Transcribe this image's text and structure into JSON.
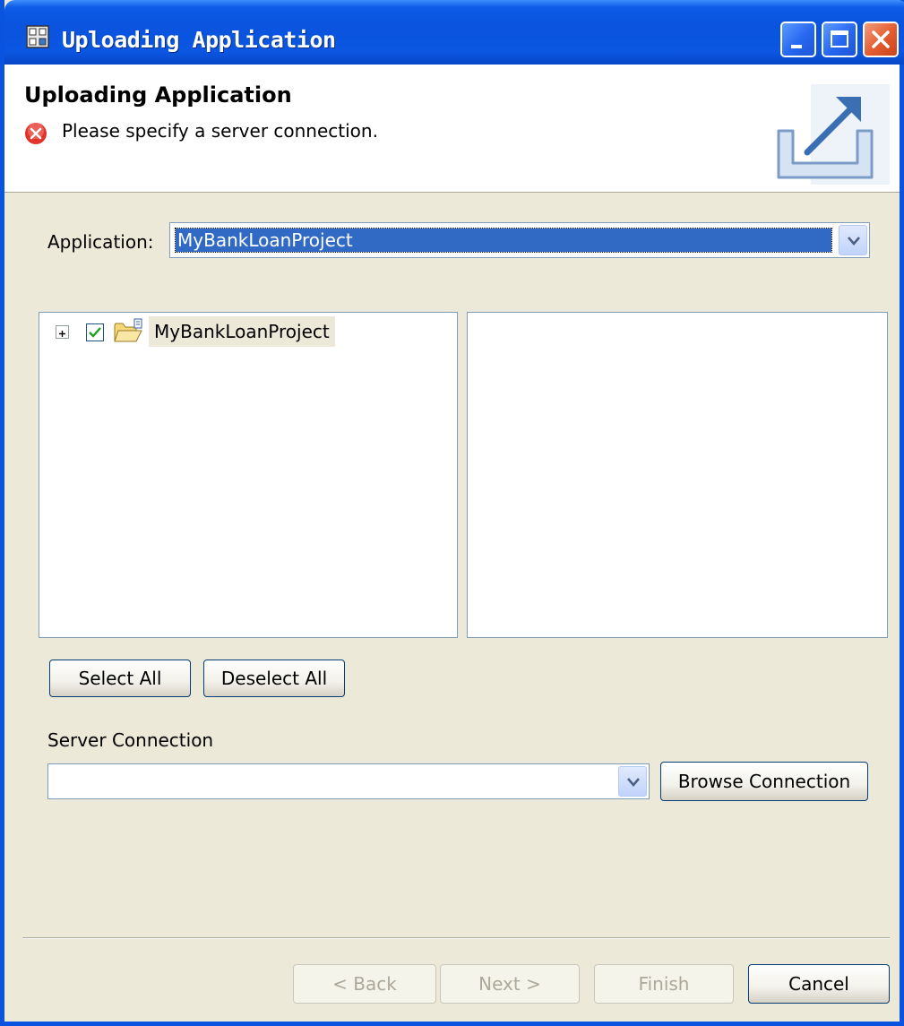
{
  "window": {
    "title": "Uploading Application"
  },
  "header": {
    "title": "Uploading Application",
    "message": "Please specify a server connection.",
    "message_icon": "error-icon",
    "graphic_icon": "upload-icon"
  },
  "application": {
    "label": "Application:",
    "selected_value": "MyBankLoanProject"
  },
  "tree": {
    "items": [
      {
        "label": "MyBankLoanProject",
        "checked": true,
        "expanded": false
      }
    ]
  },
  "selection_buttons": {
    "select_all": "Select All",
    "deselect_all": "Deselect All"
  },
  "server_connection": {
    "label": "Server Connection",
    "value": "",
    "browse_button": "Browse Connection"
  },
  "footer": {
    "back": "< Back",
    "next": "Next >",
    "finish": "Finish",
    "cancel": "Cancel"
  },
  "colors": {
    "titlebar": "#0a54df",
    "dialog_background": "#ece9d8",
    "selection": "#316ac5",
    "error": "#e0332b"
  }
}
